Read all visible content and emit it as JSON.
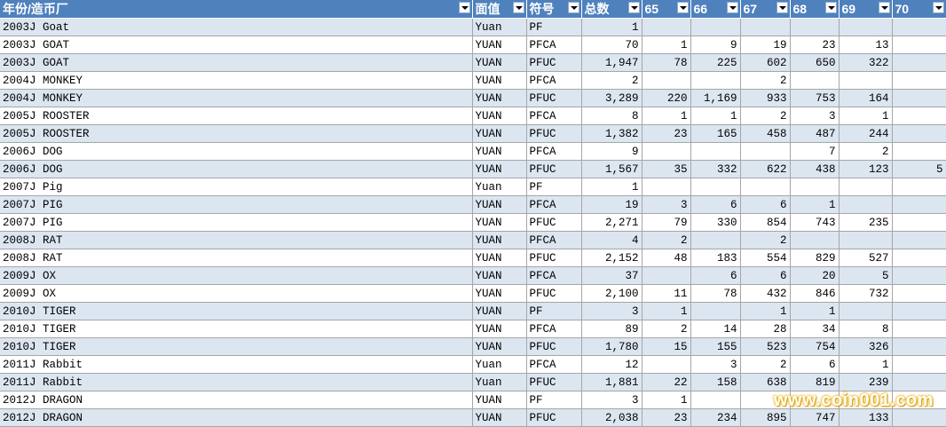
{
  "headers": [
    "年份/造币厂",
    "面值",
    "符号",
    "总数",
    "65",
    "66",
    "67",
    "68",
    "69",
    "70"
  ],
  "rows": [
    [
      "2003J Goat",
      "Yuan",
      "PF",
      "1",
      "",
      "",
      "",
      "",
      "",
      ""
    ],
    [
      "2003J GOAT",
      "YUAN",
      "PFCA",
      "70",
      "1",
      "9",
      "19",
      "23",
      "13",
      ""
    ],
    [
      "2003J GOAT",
      "YUAN",
      "PFUC",
      "1,947",
      "78",
      "225",
      "602",
      "650",
      "322",
      ""
    ],
    [
      "2004J MONKEY",
      "YUAN",
      "PFCA",
      "2",
      "",
      "",
      "2",
      "",
      "",
      ""
    ],
    [
      "2004J MONKEY",
      "YUAN",
      "PFUC",
      "3,289",
      "220",
      "1,169",
      "933",
      "753",
      "164",
      ""
    ],
    [
      "2005J ROOSTER",
      "YUAN",
      "PFCA",
      "8",
      "1",
      "1",
      "2",
      "3",
      "1",
      ""
    ],
    [
      "2005J ROOSTER",
      "YUAN",
      "PFUC",
      "1,382",
      "23",
      "165",
      "458",
      "487",
      "244",
      ""
    ],
    [
      "2006J DOG",
      "YUAN",
      "PFCA",
      "9",
      "",
      "",
      "",
      "7",
      "2",
      ""
    ],
    [
      "2006J DOG",
      "YUAN",
      "PFUC",
      "1,567",
      "35",
      "332",
      "622",
      "438",
      "123",
      "5"
    ],
    [
      "2007J Pig",
      "Yuan",
      "PF",
      "1",
      "",
      "",
      "",
      "",
      "",
      ""
    ],
    [
      "2007J PIG",
      "YUAN",
      "PFCA",
      "19",
      "3",
      "6",
      "6",
      "1",
      "",
      ""
    ],
    [
      "2007J PIG",
      "YUAN",
      "PFUC",
      "2,271",
      "79",
      "330",
      "854",
      "743",
      "235",
      ""
    ],
    [
      "2008J RAT",
      "YUAN",
      "PFCA",
      "4",
      "2",
      "",
      "2",
      "",
      "",
      ""
    ],
    [
      "2008J RAT",
      "YUAN",
      "PFUC",
      "2,152",
      "48",
      "183",
      "554",
      "829",
      "527",
      ""
    ],
    [
      "2009J OX",
      "YUAN",
      "PFCA",
      "37",
      "",
      "6",
      "6",
      "20",
      "5",
      ""
    ],
    [
      "2009J OX",
      "YUAN",
      "PFUC",
      "2,100",
      "11",
      "78",
      "432",
      "846",
      "732",
      ""
    ],
    [
      "2010J TIGER",
      "YUAN",
      "PF",
      "3",
      "1",
      "",
      "1",
      "1",
      "",
      ""
    ],
    [
      "2010J TIGER",
      "YUAN",
      "PFCA",
      "89",
      "2",
      "14",
      "28",
      "34",
      "8",
      ""
    ],
    [
      "2010J TIGER",
      "YUAN",
      "PFUC",
      "1,780",
      "15",
      "155",
      "523",
      "754",
      "326",
      ""
    ],
    [
      "2011J Rabbit",
      "Yuan",
      "PFCA",
      "12",
      "",
      "3",
      "2",
      "6",
      "1",
      ""
    ],
    [
      "2011J Rabbit",
      "Yuan",
      "PFUC",
      "1,881",
      "22",
      "158",
      "638",
      "819",
      "239",
      ""
    ],
    [
      "2012J DRAGON",
      "YUAN",
      "PF",
      "3",
      "1",
      "",
      "",
      "",
      "",
      ""
    ],
    [
      "2012J DRAGON",
      "YUAN",
      "PFUC",
      "2,038",
      "23",
      "234",
      "895",
      "747",
      "133",
      ""
    ]
  ],
  "watermark": "www.coin001.com",
  "colors": {
    "header_bg": "#4f81bd",
    "band": "#dce6f1",
    "grid": "#a6a6a6",
    "watermark_glow": "#f0b400"
  }
}
